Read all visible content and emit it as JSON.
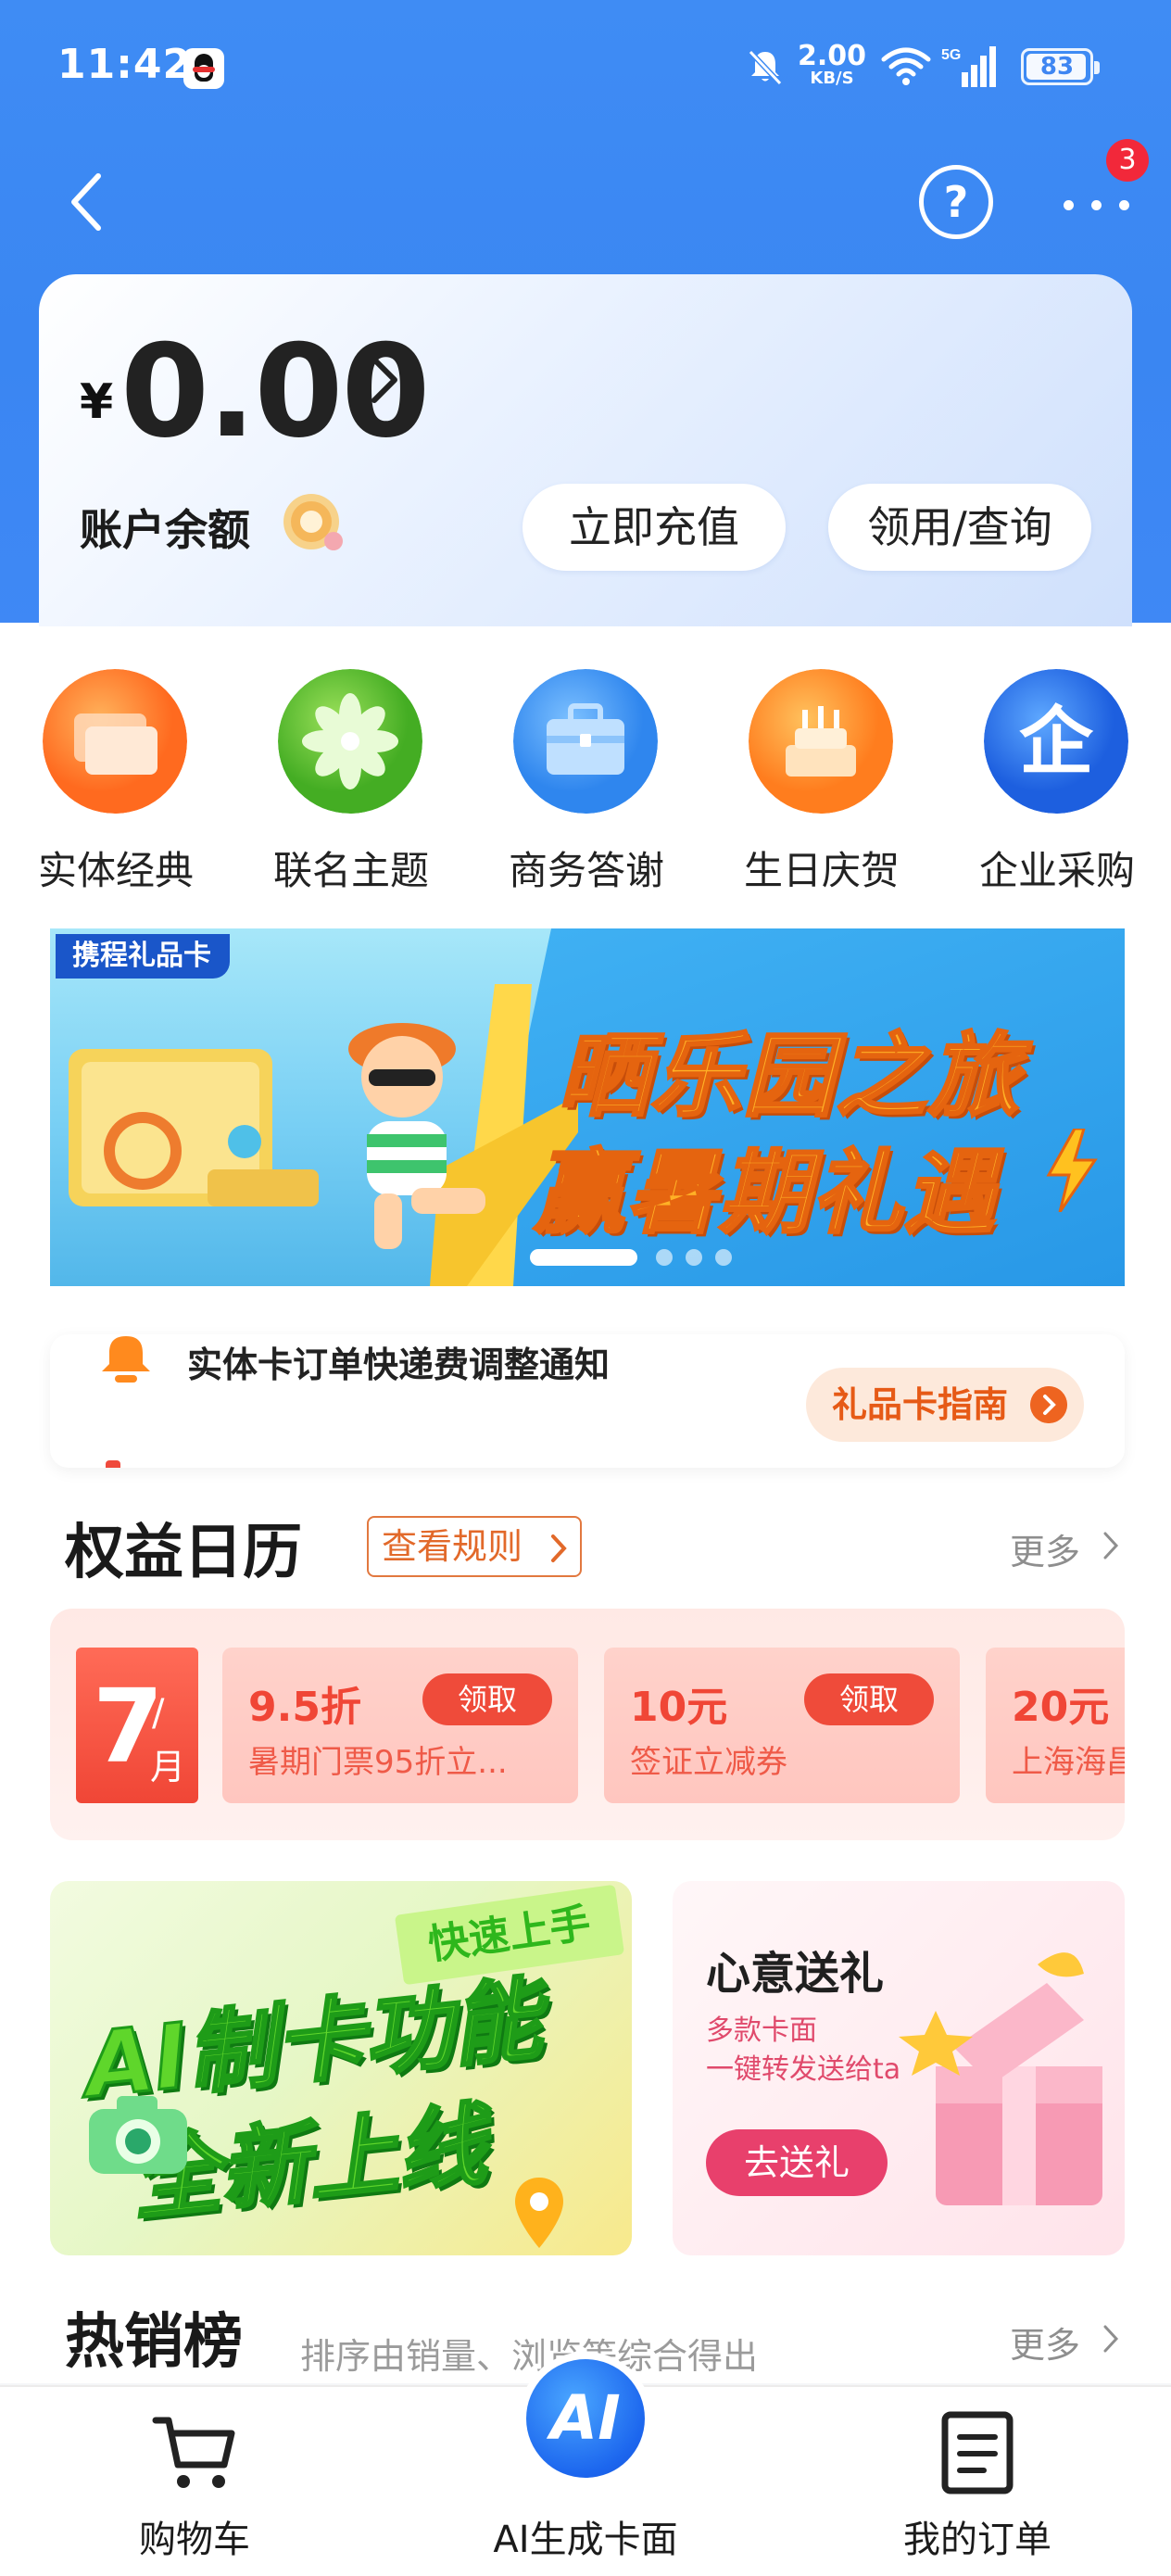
{
  "status_bar": {
    "time": "11:42",
    "net_speed_value": "2.00",
    "net_speed_unit": "KB/S",
    "network": "5G",
    "battery": "83"
  },
  "nav": {
    "more_badge": "3",
    "help_glyph": "?"
  },
  "balance": {
    "currency": "¥",
    "amount": "0.00",
    "label": "账户余额",
    "recharge_label": "立即充值",
    "collect_label": "领用/查询"
  },
  "categories": [
    {
      "label": "实体经典",
      "icon": "card-stack-icon",
      "color": "#ff7a2a"
    },
    {
      "label": "联名主题",
      "icon": "flower-icon",
      "color": "#5cc02e"
    },
    {
      "label": "商务答谢",
      "icon": "briefcase-icon",
      "color": "#3b8ff0"
    },
    {
      "label": "生日庆贺",
      "icon": "cake-icon",
      "color": "#ff8a24"
    },
    {
      "label": "企业采购",
      "icon": "enterprise-icon",
      "color": "#2a73ea"
    }
  ],
  "banner": {
    "tag": "携程礼品卡",
    "line1": "晒乐园之旅",
    "line2": "赢暑期礼遇",
    "page_count": 4,
    "active_page": 1
  },
  "notice": {
    "text": "实体卡订单快递费调整通知",
    "guide_label": "礼品卡指南"
  },
  "calendar": {
    "title": "权益日历",
    "rules_label": "查看规则",
    "more_label": "更多",
    "month_number": "7",
    "month_slash": "/",
    "month_unit": "月",
    "coupons": [
      {
        "value": "9.5折",
        "desc": "暑期门票95折立...",
        "action": "领取"
      },
      {
        "value": "10元",
        "desc": "签证立减券",
        "action": "领取"
      },
      {
        "value": "20元",
        "desc": "上海海昌",
        "action": ""
      }
    ]
  },
  "promo": {
    "ai_tag": "快速上手",
    "ai_line1": "AI制卡功能",
    "ai_line2": "全新上线",
    "gift_title": "心意送礼",
    "gift_sub1": "多款卡面",
    "gift_sub2": "一键转发送给ta",
    "gift_button": "去送礼"
  },
  "hot": {
    "title": "热销榜",
    "subtitle": "排序由销量、浏览等综合得出",
    "more_label": "更多"
  },
  "bottom_nav": {
    "cart_label": "购物车",
    "ai_label": "AI生成卡面",
    "ai_glyph": "AI",
    "orders_label": "我的订单"
  },
  "colors": {
    "header_blue": "#3f8cf4",
    "accent_orange": "#e65a16",
    "coupon_red": "#f04636"
  }
}
